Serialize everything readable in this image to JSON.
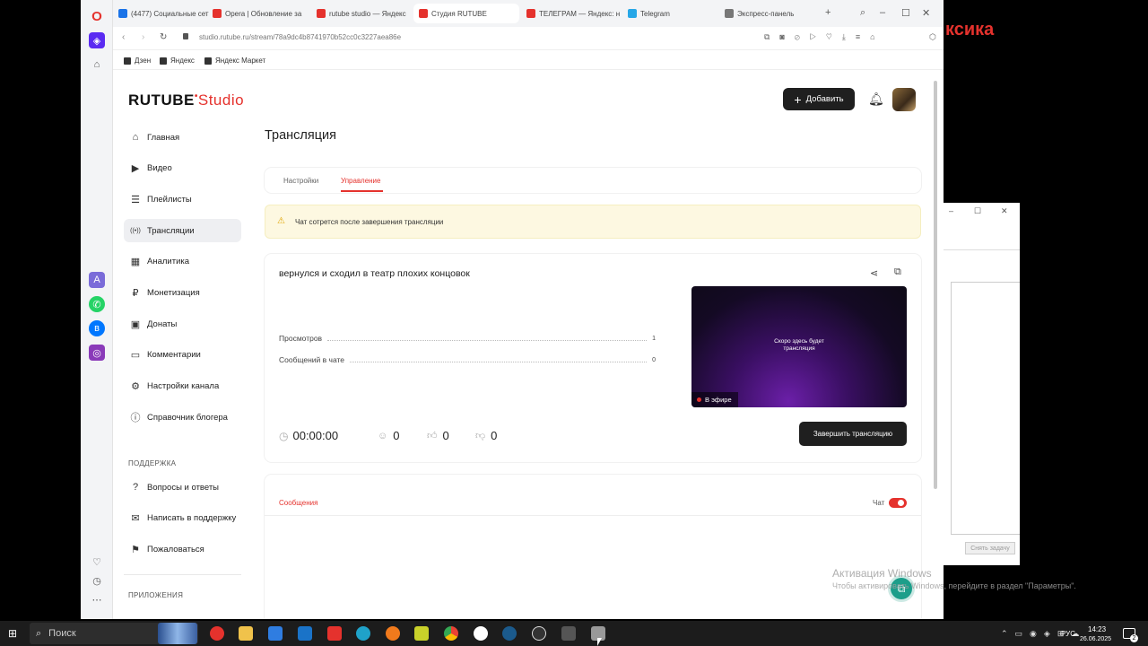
{
  "browser": {
    "tabs": [
      {
        "label": "(4477) Социальные сет",
        "color": "#1a73e8"
      },
      {
        "label": "Opera | Обновление за",
        "color": "#e5322d"
      },
      {
        "label": "rutube studio — Яндекс",
        "color": "#e5322d"
      },
      {
        "label": "Студия RUTUBE",
        "color": "#e5322d",
        "active": true
      },
      {
        "label": "ТЕЛЕГРАМ — Яндекс: н",
        "color": "#e5322d"
      },
      {
        "label": "Telegram",
        "color": "#27a7e7"
      },
      {
        "label": "Экспресс-панель",
        "color": "#777777"
      }
    ],
    "url": "studio.rutube.ru/stream/78a9dc4b8741970b52cc0c3227aea86e",
    "bookmarks": [
      "Дзен",
      "Яндекс",
      "Яндекс Маркет"
    ]
  },
  "header": {
    "logo_main": "RUTUBE",
    "logo_studio": "Studio",
    "add_label": "Добавить"
  },
  "sidebar": {
    "items": [
      {
        "label": "Главная",
        "icon": "home-icon"
      },
      {
        "label": "Видео",
        "icon": "video-icon"
      },
      {
        "label": "Плейлисты",
        "icon": "playlist-icon"
      },
      {
        "label": "Трансляции",
        "icon": "broadcast-icon",
        "active": true
      },
      {
        "label": "Аналитика",
        "icon": "analytics-icon"
      },
      {
        "label": "Монетизация",
        "icon": "ruble-icon"
      },
      {
        "label": "Донаты",
        "icon": "wallet-icon"
      },
      {
        "label": "Комментарии",
        "icon": "comment-icon"
      },
      {
        "label": "Настройки канала",
        "icon": "gear-icon"
      },
      {
        "label": "Справочник блогера",
        "icon": "info-icon"
      }
    ],
    "support_label": "ПОДДЕРЖКА",
    "support_items": [
      {
        "label": "Вопросы и ответы",
        "icon": "question-icon"
      },
      {
        "label": "Написать в поддержку",
        "icon": "mail-icon"
      },
      {
        "label": "Пожаловаться",
        "icon": "flag-icon"
      }
    ],
    "apps_label": "ПРИЛОЖЕНИЯ"
  },
  "main": {
    "page_title": "Трансляция",
    "tabs": [
      "Настройки",
      "Управление"
    ],
    "active_tab": "Управление",
    "notice": "Чат сотрется после завершения трансляции",
    "stream_title": "вернулся и сходил в театр плохих концовок",
    "stats": [
      {
        "label": "Просмотров",
        "value": "1"
      },
      {
        "label": "Сообщений в чате",
        "value": "0"
      }
    ],
    "preview_text": "Скоро здесь будет трансляция",
    "live_badge": "В эфире",
    "timer": "00:00:00",
    "viewers": "0",
    "likes": "0",
    "dislikes": "0",
    "end_button": "Завершить трансляцию",
    "messages_tab": "Сообщения",
    "chat_label": "Чат",
    "chat_enabled": true
  },
  "overlay": {
    "activation_title": "Активация Windows",
    "activation_text": "Чтобы активировать Windows, перейдите в раздел \"Параметры\".",
    "bg_text": "ксика",
    "side_button": "Снять задачу"
  },
  "taskbar": {
    "search_label": "Поиск",
    "lang": "РУС",
    "time": "14:23",
    "date": "26.06.2025",
    "notif_count": "2"
  },
  "colors": {
    "accent": "#e5322d",
    "notice_bg": "#fdf8e1",
    "preview_purple": "#6b1fa8"
  }
}
